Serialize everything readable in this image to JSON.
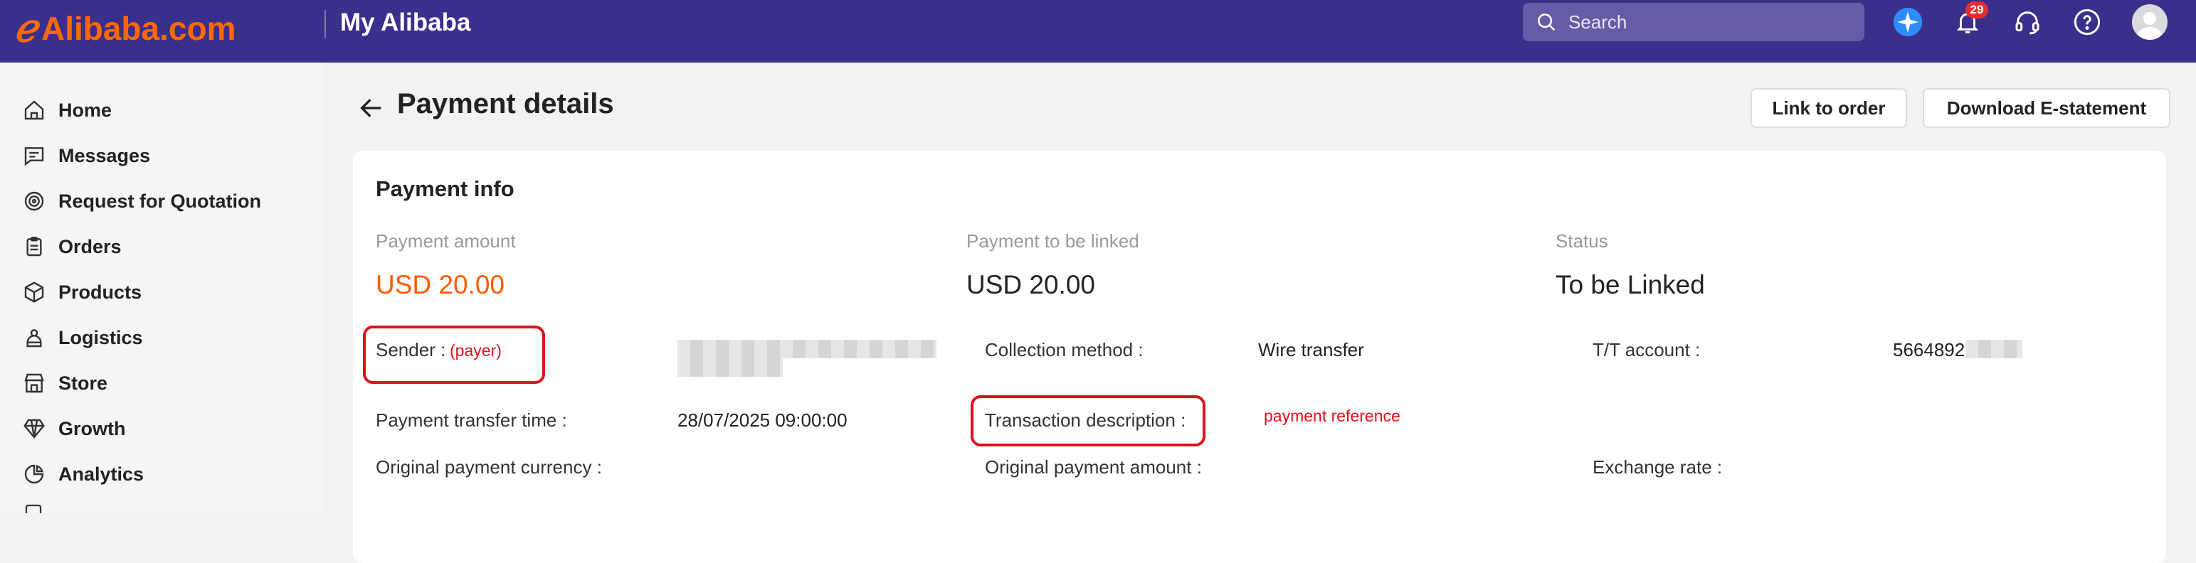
{
  "header": {
    "logo_mark": "ℯ",
    "logo_text": "Alibaba.com",
    "app_title": "My Alibaba",
    "search_placeholder": "Search",
    "notifications_count": "29",
    "icons": [
      "ai-assistant-icon",
      "bell-icon",
      "headset-icon",
      "help-icon",
      "avatar"
    ]
  },
  "sidebar": {
    "items": [
      {
        "label": "Home",
        "icon": "home-icon"
      },
      {
        "label": "Messages",
        "icon": "messages-icon"
      },
      {
        "label": "Request for Quotation",
        "icon": "target-icon"
      },
      {
        "label": "Orders",
        "icon": "clipboard-icon"
      },
      {
        "label": "Products",
        "icon": "box-icon"
      },
      {
        "label": "Logistics",
        "icon": "logistics-icon"
      },
      {
        "label": "Store",
        "icon": "store-icon"
      },
      {
        "label": "Growth",
        "icon": "diamond-icon"
      },
      {
        "label": "Analytics",
        "icon": "analytics-icon"
      }
    ]
  },
  "page": {
    "title": "Payment details",
    "link_to_order": "Link to order",
    "download_statement": "Download E-statement"
  },
  "payment_info": {
    "title": "Payment info",
    "payment_amount_label": "Payment amount",
    "payment_amount_value": "USD 20.00",
    "payment_to_link_label": "Payment to be linked",
    "payment_to_link_value": "USD 20.00",
    "status_label": "Status",
    "status_value": "To be Linked",
    "sender_label": "Sender",
    "sender_annotation": "(payer)",
    "collection_method_label": "Collection method",
    "collection_method_value": "Wire transfer",
    "tt_account_label": "T/T account",
    "tt_account_value": "5664892",
    "transfer_time_label": "Payment transfer time",
    "transfer_time_value": "28/07/2025 09:00:00",
    "transaction_desc_label": "Transaction description",
    "transaction_desc_annotation": "payment reference",
    "orig_currency_label": "Original payment currency",
    "orig_amount_label": "Original payment amount",
    "exchange_rate_label": "Exchange rate",
    "colon": ":"
  },
  "colors": {
    "header_bg": "#3b2f8c",
    "brand_orange": "#ff6a00",
    "amount_orange": "#ff5a00",
    "annotation_red": "#e0101a"
  }
}
